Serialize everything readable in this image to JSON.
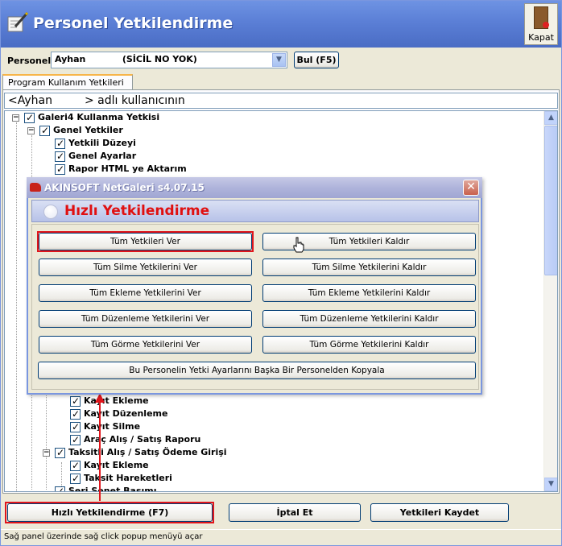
{
  "window": {
    "title": "Personel Yetkilendirme",
    "close_label": "Kapat"
  },
  "personnel": {
    "label": "Personel",
    "name": "Ayhan",
    "sicil": "(SİCİL NO YOK)",
    "find_button": "Bul (F5)"
  },
  "tabs": [
    {
      "label": "Program Kullanım Yetkileri"
    }
  ],
  "user_header": {
    "part1": "<Ayhan",
    "part2": "> adlı kullanıcının"
  },
  "tree_top": [
    {
      "label": "Galeri4 Kullanma Yetkisi"
    },
    {
      "label": "Genel Yetkiler"
    },
    {
      "label": "Yetkili Düzeyi"
    },
    {
      "label": "Genel Ayarlar"
    },
    {
      "label": "Rapor HTML ye Aktarım"
    }
  ],
  "tree_bottom": [
    {
      "label": "Kayıt Ekleme"
    },
    {
      "label": "Kayıt Düzenleme"
    },
    {
      "label": "Kayıt Silme"
    },
    {
      "label": "Araç Alış / Satış Raporu"
    },
    {
      "label": "Taksitli Alış / Satış Ödeme Girişi"
    },
    {
      "label": "Kayıt Ekleme"
    },
    {
      "label": "Taksit Hareketleri"
    },
    {
      "label": "Seri Senet Basımı"
    }
  ],
  "dialog": {
    "title": "AKINSOFT NetGaleri s4.07.15",
    "heading": "Hızlı Yetkilendirme",
    "buttons_left": [
      "Tüm Yetkileri Ver",
      "Tüm Silme Yetkilerini Ver",
      "Tüm Ekleme Yetkilerini Ver",
      "Tüm Düzenleme Yetkilerini Ver",
      "Tüm Görme Yetkilerini Ver"
    ],
    "buttons_right": [
      "Tüm Yetkileri Kaldır",
      "Tüm Silme Yetkilerini Kaldır",
      "Tüm Ekleme Yetkilerini Kaldır",
      "Tüm Düzenleme Yetkilerini Kaldır",
      "Tüm Görme Yetkilerini Kaldır"
    ],
    "copy_button": "Bu Personelin Yetki Ayarlarını  Başka Bir Personelden Kopyala"
  },
  "bottom_buttons": {
    "quick": "Hızlı Yetkilendirme (F7)",
    "cancel": "İptal Et",
    "save": "Yetkileri Kaydet"
  },
  "status": "Sağ panel üzerinde sağ click popup menüyü açar",
  "colors": {
    "highlight_red": "#E0151B",
    "title_blue": "#5B7FD6",
    "dialog_heading": "#E01010"
  }
}
